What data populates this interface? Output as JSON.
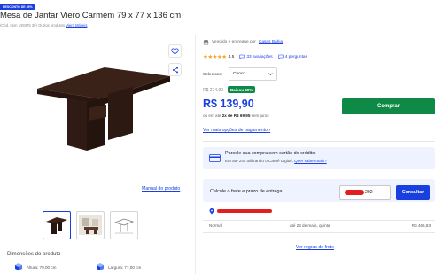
{
  "product": {
    "discount_badge": "DESCONTO DE 49%",
    "title": "Mesa de Jantar Viero Carmem 79 x 77 x 136 cm",
    "code_text": "(Cód. Item 139375 39)",
    "other_products_label": "Outros produtos",
    "brand_link": "Viero Móveis",
    "manual_link": "Manual do produto",
    "dimensions_title": "Dimensões do produto",
    "height": "Altura: 79,00 cm",
    "width": "Largura: 77,00 cm",
    "wood_color": "#3a2219"
  },
  "seller": {
    "prefix": "Vendido e entregue por",
    "name": "Casas Bahia"
  },
  "rating": {
    "stars": "★★★★★",
    "score": "4.5",
    "reviews": "33 avaliações",
    "questions": "4 perguntas"
  },
  "selector": {
    "label": "Selecione:",
    "value": "Choco"
  },
  "pricing": {
    "old_price": "R$ 274,90",
    "discount_badge": "Baixou 49%",
    "price": "R$ 139,90",
    "installments_prefix": "ou em até",
    "installments_value": "2x de R$ 69,95",
    "installments_suffix": "sem juros",
    "buy_button": "Comprar",
    "payment_link": "Ver mais opções de pagamento"
  },
  "promo": {
    "title": "Parcele sua compra sem cartão de crédito.",
    "subtitle": "Em até 24x utilizando o Carnê Digital.",
    "link": "Quer saber mais?"
  },
  "freight": {
    "label": "Calcule o frete e prazo de entrega",
    "cep_suffix": "292",
    "calc_button": "Consultar",
    "row_type": "Normal",
    "row_date": "até 23 de maio, quinta",
    "row_price": "R$ 465,83",
    "rules_link": "Ver regras de frete"
  },
  "colors": {
    "accent_blue": "#1a3fe0",
    "buy_green": "#0f8a46",
    "redaction_red": "#e02020"
  }
}
